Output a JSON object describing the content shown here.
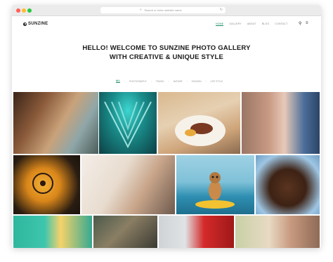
{
  "browser": {
    "url_placeholder": "Search or enter website name"
  },
  "site": {
    "logo": "SUNZINE",
    "nav": [
      "HOME",
      "GALLERY",
      "ABOUT",
      "BLOG",
      "CONTACT"
    ],
    "icons": [
      "search-icon",
      "menu-icon"
    ]
  },
  "hero": {
    "line1": "HELLO! WELCOME TO SUNZINE PHOTO GALLERY",
    "line2": "WITH CREATIVE & UNIQUE STYLE"
  },
  "filters": [
    "ALL",
    "PHOTOGRAPHY",
    "TRAVEL",
    "NATURE",
    "FASHION",
    "LIFE STYLE"
  ],
  "colors": {
    "accent": "#1a8a6a",
    "text": "#1a1a1a"
  }
}
